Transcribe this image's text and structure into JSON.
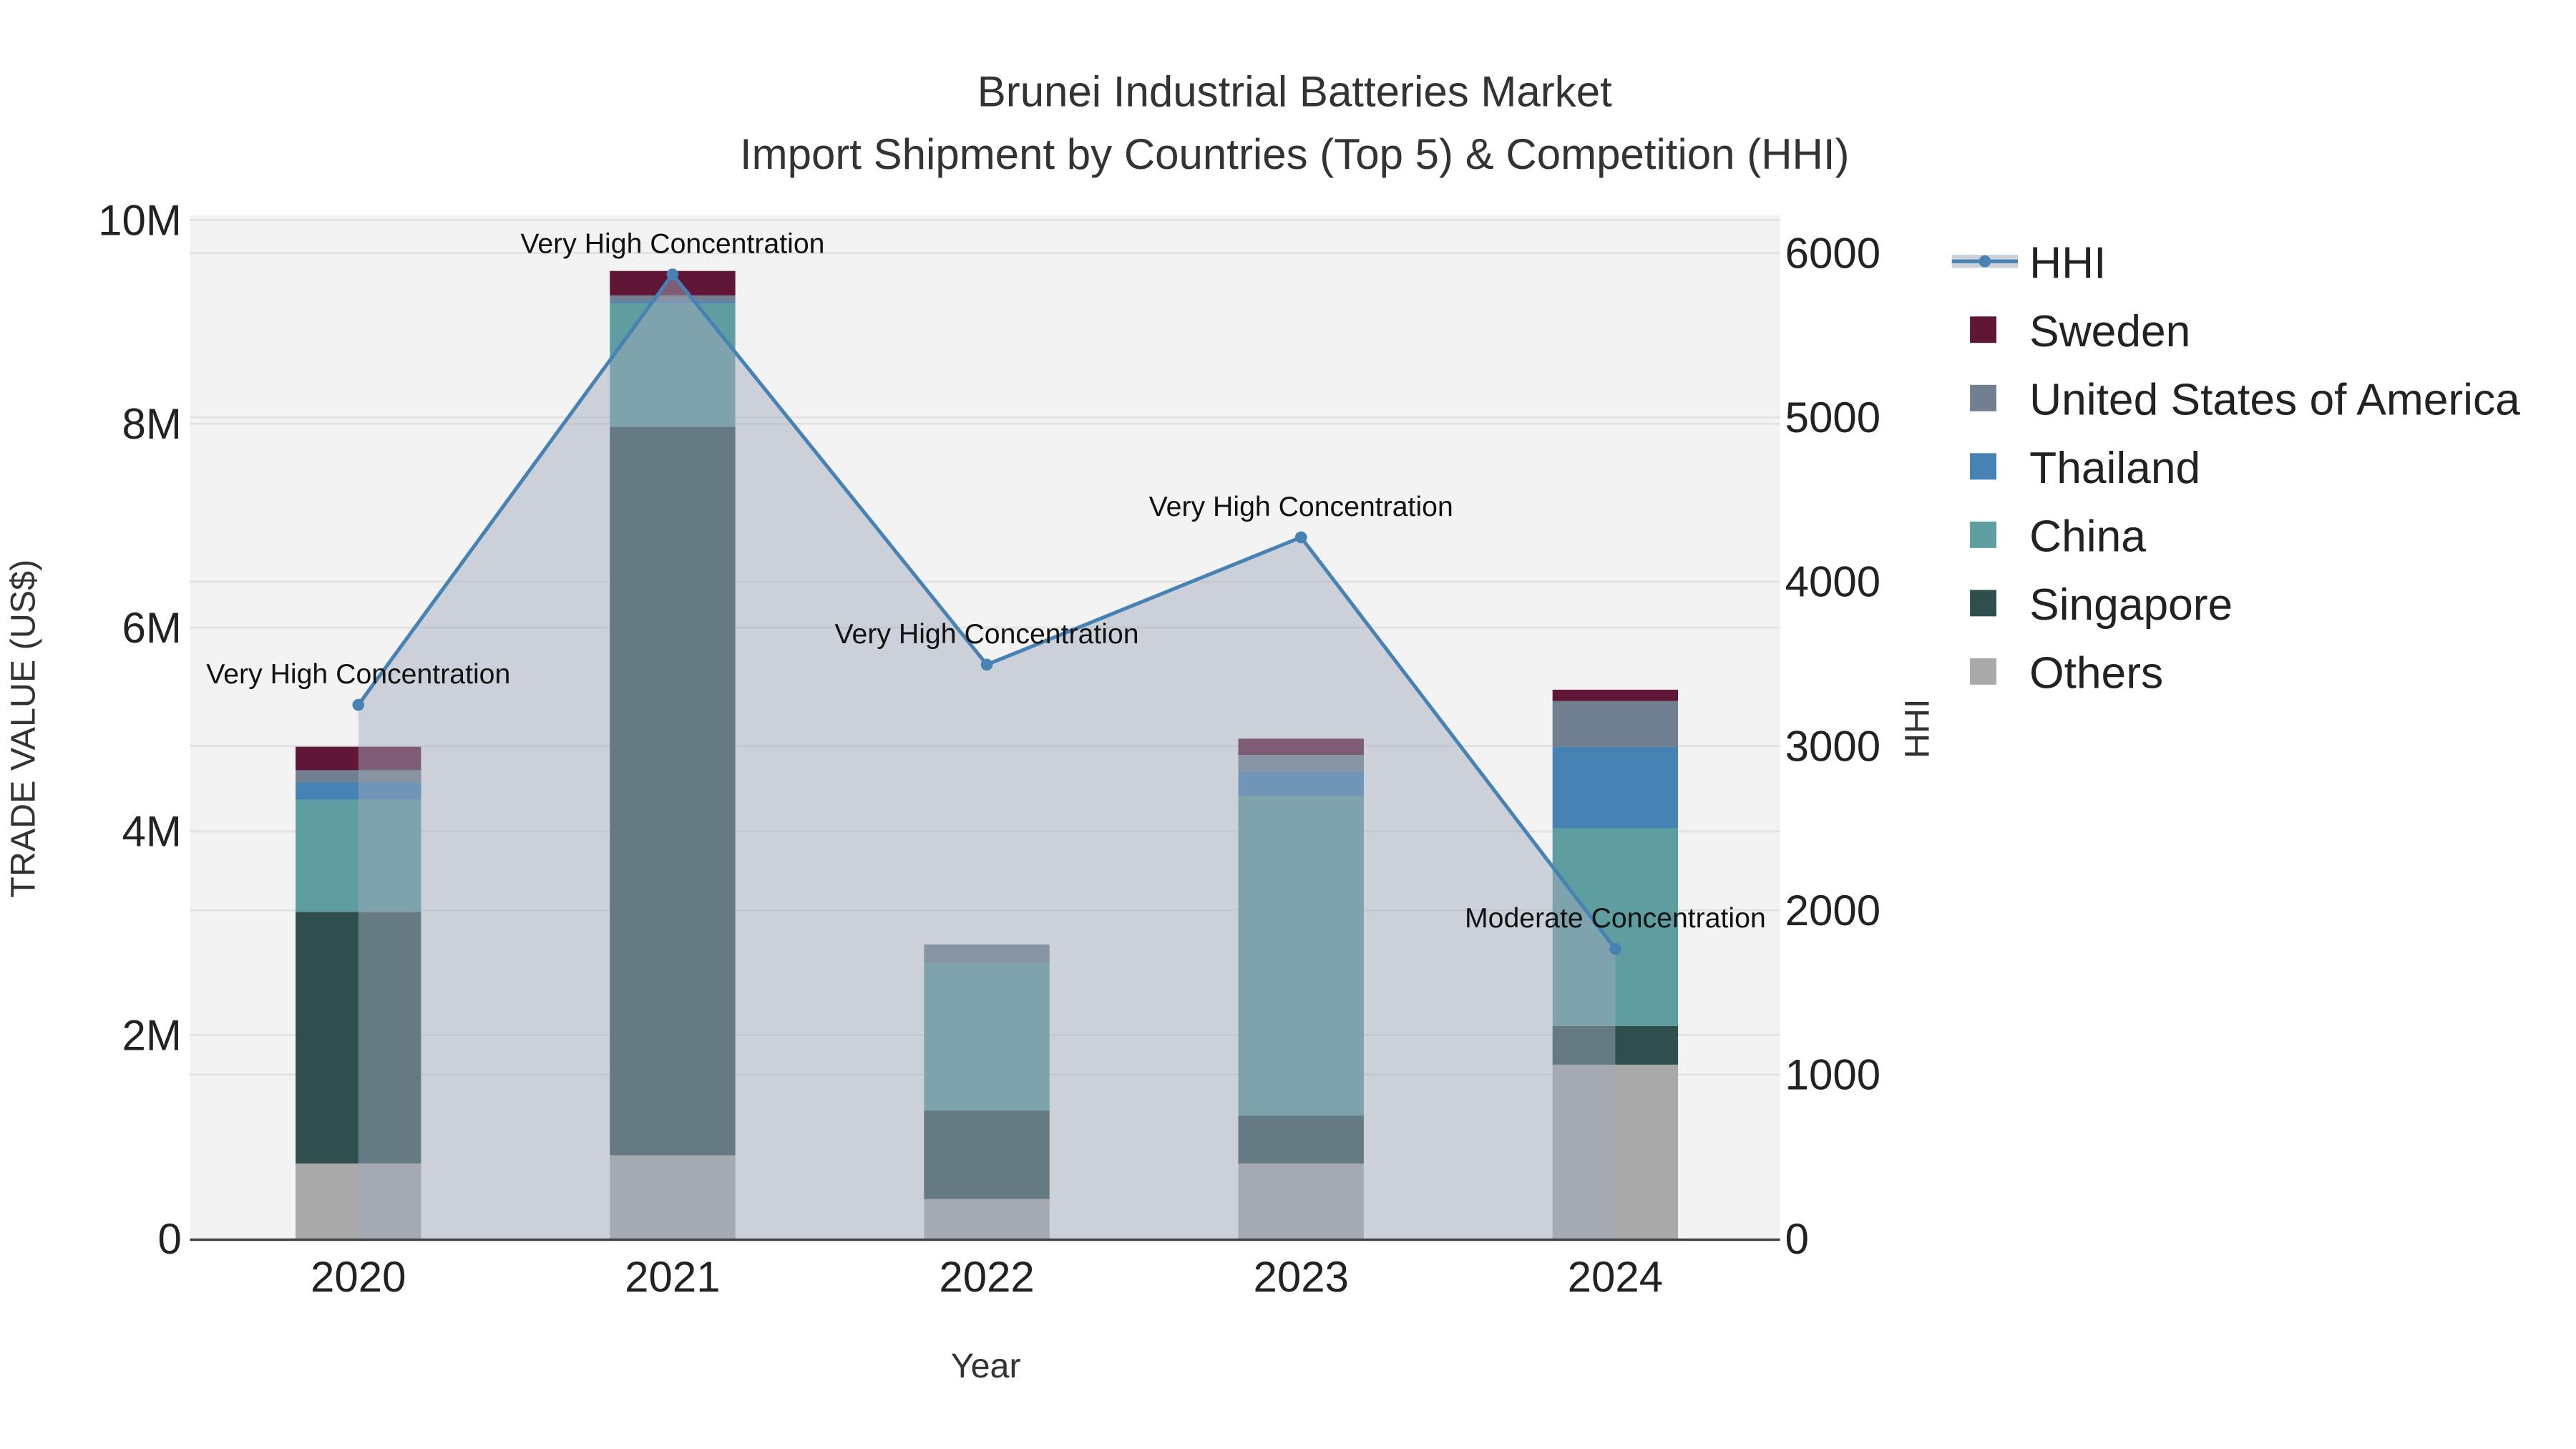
{
  "chart_data": {
    "type": "bar",
    "title": "Brunei Industrial Batteries Market",
    "subtitle": "Import Shipment by Countries (Top 5) & Competition (HHI)",
    "xlabel": "Year",
    "ylabel": "TRADE VALUE (US$)",
    "y2label": "HHI",
    "categories": [
      "2020",
      "2021",
      "2022",
      "2023",
      "2024"
    ],
    "ylim": [
      0,
      10000000
    ],
    "y2lim": [
      0,
      6200
    ],
    "yticks": [
      0,
      2000000,
      4000000,
      6000000,
      8000000,
      10000000
    ],
    "ytick_labels": [
      "0",
      "2M",
      "4M",
      "6M",
      "8M",
      "10M"
    ],
    "y2ticks": [
      0,
      1000,
      2000,
      3000,
      4000,
      5000,
      6000
    ],
    "y2tick_labels": [
      "0",
      "1000",
      "2000",
      "3000",
      "4000",
      "5000",
      "6000"
    ],
    "barmode": "stack",
    "series": [
      {
        "name": "Others",
        "color": "#a9a9a9",
        "values": [
          740000,
          820000,
          390000,
          740000,
          1710000
        ]
      },
      {
        "name": "Singapore",
        "color": "#2f4f4f",
        "values": [
          2470000,
          7150000,
          870000,
          470000,
          380000
        ]
      },
      {
        "name": "China",
        "color": "#5f9ea0",
        "values": [
          1100000,
          1210000,
          1450000,
          3140000,
          1940000
        ]
      },
      {
        "name": "Thailand",
        "color": "#4682b4",
        "values": [
          170000,
          20000,
          0,
          240000,
          800000
        ]
      },
      {
        "name": "United States of America",
        "color": "#708090",
        "values": [
          120000,
          60000,
          180000,
          160000,
          450000
        ]
      },
      {
        "name": "Sweden",
        "color": "#5f1637",
        "values": [
          230000,
          240000,
          0,
          160000,
          110000
        ]
      }
    ],
    "line": {
      "name": "HHI",
      "color": "#4682b4",
      "axis": "right",
      "values": [
        3250,
        5870,
        3495,
        4270,
        1765
      ],
      "annotations": [
        "Very High Concentration",
        "Very High Concentration",
        "Very High Concentration",
        "Very High Concentration",
        "Moderate Concentration"
      ]
    },
    "legend_order": [
      "HHI",
      "Sweden",
      "United States of America",
      "Thailand",
      "China",
      "Singapore",
      "Others"
    ],
    "legend_position": "right",
    "grid": true,
    "plot_background": "#f3f3f3"
  }
}
